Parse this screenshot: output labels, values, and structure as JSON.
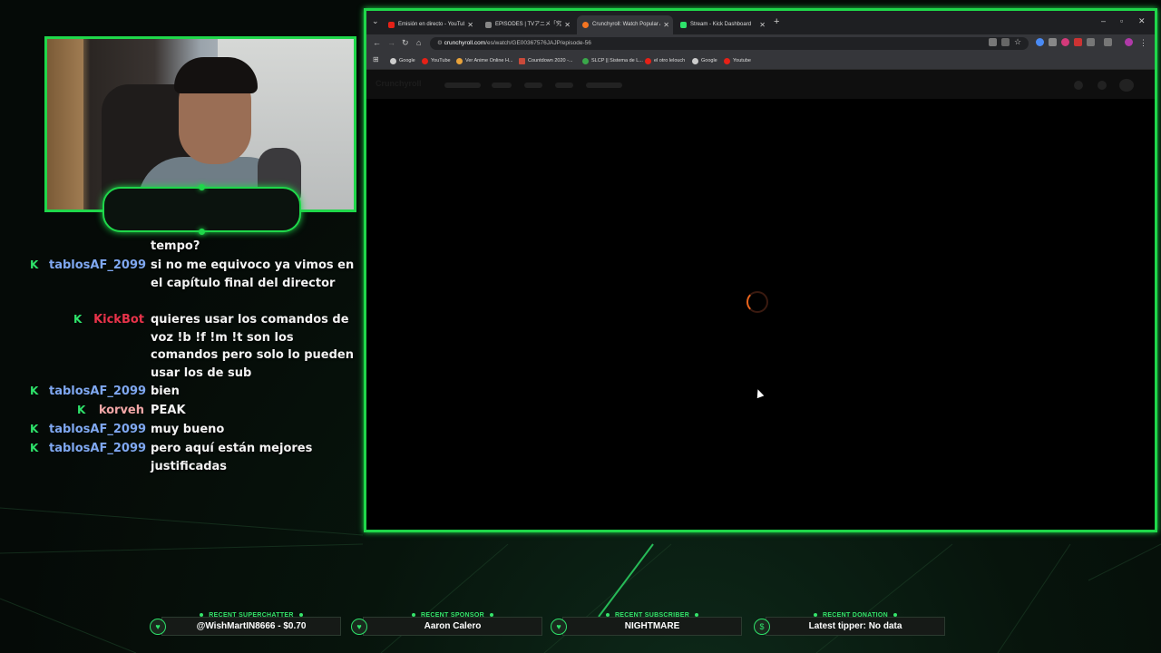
{
  "chat": {
    "messages": [
      {
        "user": "",
        "text": "tempo?",
        "user_color": ""
      },
      {
        "user": "tablosAF_2099",
        "text": "si no me equivoco ya vimos en el capítulo final del director",
        "user_color": "#7fa7f0"
      },
      {
        "user": "KickBot",
        "text": "quieres usar los comandos de voz !b !f !m !t son los comandos pero solo lo pueden usar los de sub",
        "user_color": "#e8334a"
      },
      {
        "user": "tablosAF_2099",
        "text": "bien",
        "user_color": "#7fa7f0"
      },
      {
        "user": "korveh",
        "text": "PEAK",
        "user_color": "#f2a7a7"
      },
      {
        "user": "tablosAF_2099",
        "text": "muy bueno",
        "user_color": "#7fa7f0"
      },
      {
        "user": "tablosAF_2099",
        "text": "pero aquí están mejores justificadas",
        "user_color": "#7fa7f0"
      }
    ],
    "badge_glyph": "K"
  },
  "browser": {
    "tabs": [
      {
        "label": "Emisión en directo - YouTube S",
        "icon": "youtube-icon",
        "color": "#e62117",
        "active": false
      },
      {
        "label": "EPISODES | TVアニメ「究極進化",
        "icon": "page-icon",
        "color": "#888888",
        "active": false
      },
      {
        "label": "Crunchyroll: Watch Popular Ani",
        "icon": "crunchyroll-icon",
        "color": "#f47521",
        "active": true
      },
      {
        "label": "Stream - Kick Dashboard",
        "icon": "kick-icon",
        "color": "#2ee26a",
        "active": false
      }
    ],
    "url_domain": "crunchyroll.com",
    "url_path": "/es/watch/GE00367576JAJP/episode-56",
    "bookmarks": [
      {
        "label": "Google",
        "color": "#cccccc"
      },
      {
        "label": "YouTube",
        "color": "#e62117"
      },
      {
        "label": "Ver Anime Online H...",
        "color": "#e8a23a"
      },
      {
        "label": "Countdown 2020 -...",
        "color": "#c94a3a"
      },
      {
        "label": "SLCP || Sistema de L...",
        "color": "#3aa84a"
      },
      {
        "label": "el otro lelouch",
        "color": "#e62117"
      },
      {
        "label": "Google",
        "color": "#cccccc"
      },
      {
        "label": "Youtube",
        "color": "#e62117"
      }
    ],
    "site_logo": "Crunchyroll"
  },
  "alerts": [
    {
      "title": "RECENT SUPERCHATTER",
      "value": "@WishMartIN8666 - $0.70"
    },
    {
      "title": "RECENT SPONSOR",
      "value": "Aaron Calero"
    },
    {
      "title": "RECENT SUBSCRIBER",
      "value": "NIGHTMARE"
    },
    {
      "title": "RECENT DONATION",
      "value": "Latest tipper: No data"
    }
  ],
  "colors": {
    "accent": "#1fd74a"
  }
}
